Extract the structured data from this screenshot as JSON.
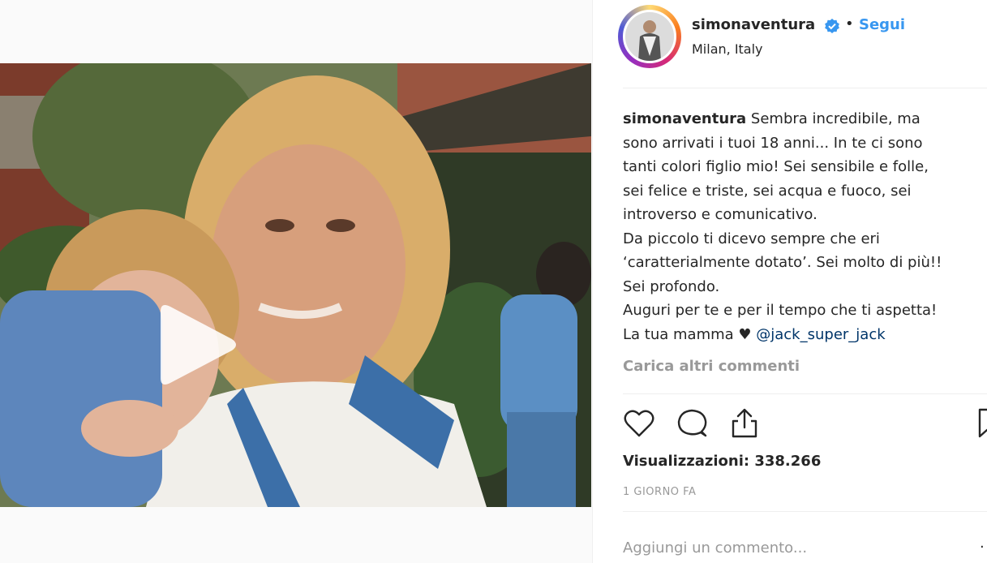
{
  "post": {
    "username": "simonaventura",
    "follow_label": "Segui",
    "separator": "•",
    "location": "Milan, Italy"
  },
  "caption": {
    "username": "simonaventura",
    "lines": [
      "Sembra incredibile, ma",
      "sono arrivati i tuoi 18 anni... In te ci sono",
      "tanti colori figlio mio! Sei sensibile e folle,",
      "sei felice e triste, sei acqua e fuoco, sei",
      "introverso e comunicativo.",
      "Da piccolo ti dicevo sempre che eri",
      "‘caratterialmente dotato’. Sei molto di più!!",
      "Sei profondo.",
      "Auguri per te e per il tempo che ti aspetta!"
    ],
    "last_line_prefix": "La tua mamma ♥ ",
    "mention": "@jack_super_jack"
  },
  "comments": {
    "load_more": "Carica altri commenti"
  },
  "stats": {
    "views": "Visualizzazioni: 338.266",
    "time": "1 GIORNO FA"
  },
  "comment_box": {
    "placeholder": "Aggiungi un commento..."
  },
  "icons": {
    "like": "heart-icon",
    "comment": "comment-icon",
    "share": "share-icon",
    "save": "bookmark-icon",
    "play": "play-icon",
    "verified": "verified-badge-icon"
  },
  "colors": {
    "link": "#3897f0",
    "mention": "#003569",
    "muted": "#999999",
    "text": "#262626"
  }
}
